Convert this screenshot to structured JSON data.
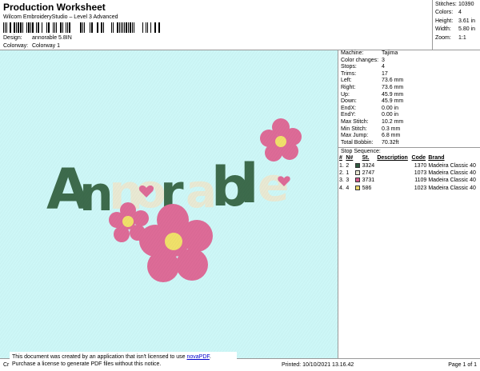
{
  "header": {
    "title": "Production Worksheet",
    "subtitle": "Wilcom EmbroideryStudio – Level 3 Advanced",
    "design_label": "Design:",
    "design_value": "annorable 5.8IN",
    "colorway_label": "Colorway:",
    "colorway_value": "Colorway 1"
  },
  "stats": [
    {
      "label": "Stitches:",
      "value": "10390"
    },
    {
      "label": "Colors:",
      "value": "4"
    },
    {
      "label": "Height:",
      "value": "3.61 in"
    },
    {
      "label": "Width:",
      "value": "5.80 in"
    },
    {
      "label": "Zoom:",
      "value": "1:1"
    }
  ],
  "params": [
    {
      "label": "Machine:",
      "value": "Tajima"
    },
    {
      "label": "Color changes:",
      "value": "3"
    },
    {
      "label": "Stops:",
      "value": "4"
    },
    {
      "label": "Trims:",
      "value": "17"
    },
    {
      "label": "Left:",
      "value": "73.6 mm"
    },
    {
      "label": "Right:",
      "value": "73.6 mm"
    },
    {
      "label": "Up:",
      "value": "45.9 mm"
    },
    {
      "label": "Down:",
      "value": "45.9 mm"
    },
    {
      "label": "EndX:",
      "value": "0.00 in"
    },
    {
      "label": "EndY:",
      "value": "0.00 in"
    },
    {
      "label": "Max Stitch:",
      "value": "10.2 mm"
    },
    {
      "label": "Min Stitch:",
      "value": "0.3 mm"
    },
    {
      "label": "Max Jump:",
      "value": "6.8 mm"
    },
    {
      "label": "Total Bobbin:",
      "value": "70.32ft"
    }
  ],
  "sequence": {
    "title": "Stop Sequence:",
    "columns": [
      "#",
      "N#",
      "",
      "St.",
      "Description",
      "Code",
      "Brand"
    ],
    "rows": [
      {
        "idx": "1.",
        "n": "2",
        "color": "#2f5a3f",
        "st": "3324",
        "desc": "",
        "code": "1370",
        "brand": "Madeira Classic 40"
      },
      {
        "idx": "2.",
        "n": "1",
        "color": "#e8e8d4",
        "st": "2747",
        "desc": "",
        "code": "1073",
        "brand": "Madeira Classic 40"
      },
      {
        "idx": "3.",
        "n": "3",
        "color": "#d65a8c",
        "st": "3731",
        "desc": "",
        "code": "1109",
        "brand": "Madeira Classic 40"
      },
      {
        "idx": "4.",
        "n": "4",
        "color": "#ecd66a",
        "st": "586",
        "desc": "",
        "code": "1023",
        "brand": "Madeira Classic 40"
      }
    ]
  },
  "design_text": "Annorable",
  "colors": {
    "canvas": "#cdf7f7",
    "green": "#3d6b4c",
    "cream": "#e9e9d3",
    "pink": "#dd6b97",
    "yellow": "#f0e06a"
  },
  "footer": {
    "left": "Cr",
    "printed": "Printed: 10/10/2021 13.16.42",
    "page": "Page 1 of 1"
  },
  "notice": {
    "line1_prefix": "This document was created by an application that isn't licensed to use ",
    "link": "novaPDF",
    "line1_suffix": ".",
    "line2": "Purchase a license to generate PDF files without this notice."
  }
}
